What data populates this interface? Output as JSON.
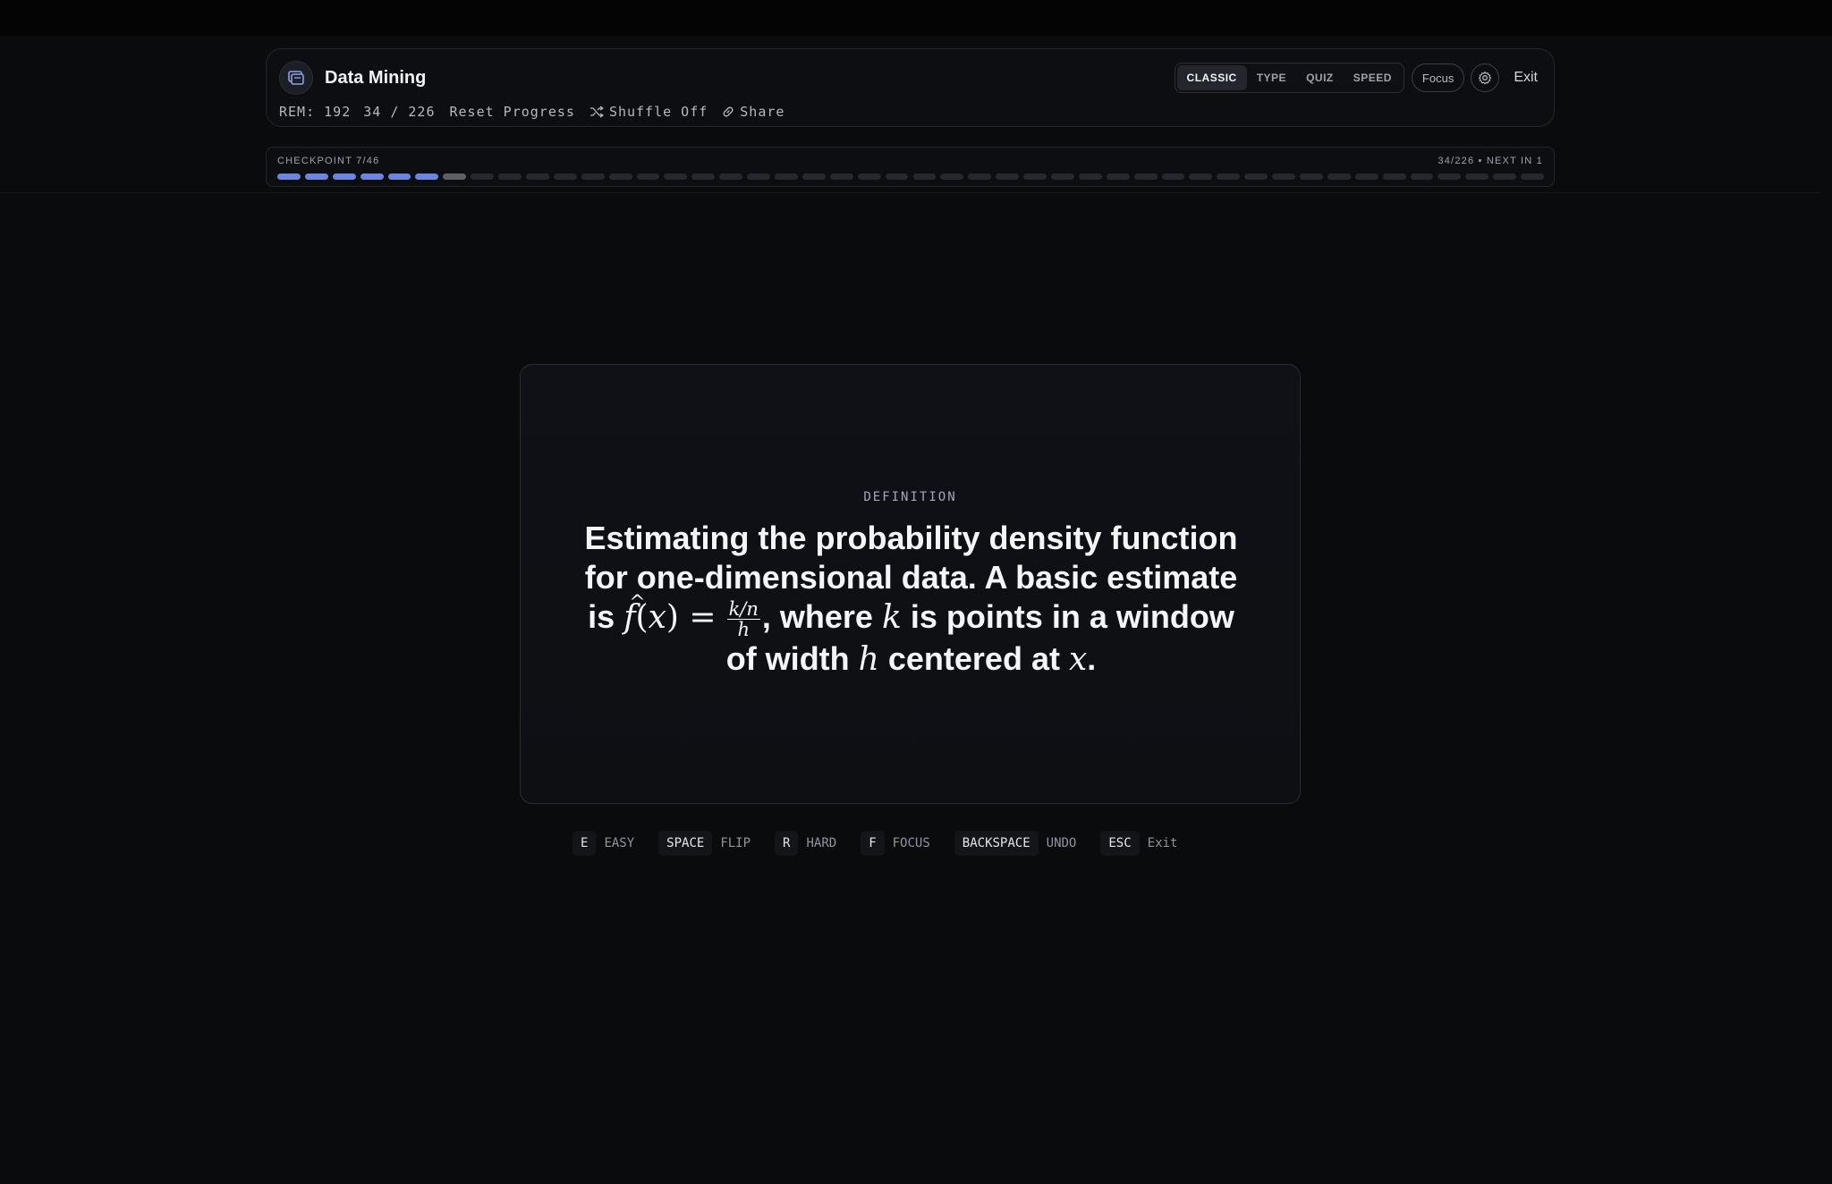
{
  "header": {
    "deck_title": "Data Mining",
    "modes": [
      "CLASSIC",
      "TYPE",
      "QUIZ",
      "SPEED"
    ],
    "active_mode": "CLASSIC",
    "focus_label": "Focus",
    "exit_label": "Exit",
    "rem_label": "REM: 192",
    "progress_label": "34 / 226",
    "reset_label": "Reset Progress",
    "shuffle_label": "Shuffle Off",
    "share_label": "Share"
  },
  "checkpoint": {
    "label": "CHECKPOINT 7/46",
    "next_label": "34/226 • NEXT IN 1",
    "total_segments": 46,
    "completed_segments": 6,
    "current_segment": 7
  },
  "card": {
    "kind": "DEFINITION",
    "text_line1": "Estimating the probability density function for one-dimensional data. A basic estimate is",
    "formula_lhs": "f(x) =",
    "frac_num": "k/n",
    "frac_den": "h",
    "text_after_frac": ", where",
    "var_k": "k",
    "text_mid": "is points in a window of width",
    "var_h": "h",
    "text_end": "centered at",
    "var_x": "x",
    "period": "."
  },
  "shortcuts": [
    {
      "key": "E",
      "action": "EASY"
    },
    {
      "key": "SPACE",
      "action": "FLIP"
    },
    {
      "key": "R",
      "action": "HARD"
    },
    {
      "key": "F",
      "action": "FOCUS"
    },
    {
      "key": "BACKSPACE",
      "action": "UNDO"
    },
    {
      "key": "ESC",
      "action": "Exit"
    }
  ],
  "colors": {
    "background": "#0a0b0d",
    "accent": "#6b86dc",
    "card_bg": "#0f1116"
  },
  "icons": [
    "deck-icon",
    "gear-icon",
    "shuffle-icon",
    "link-icon"
  ]
}
